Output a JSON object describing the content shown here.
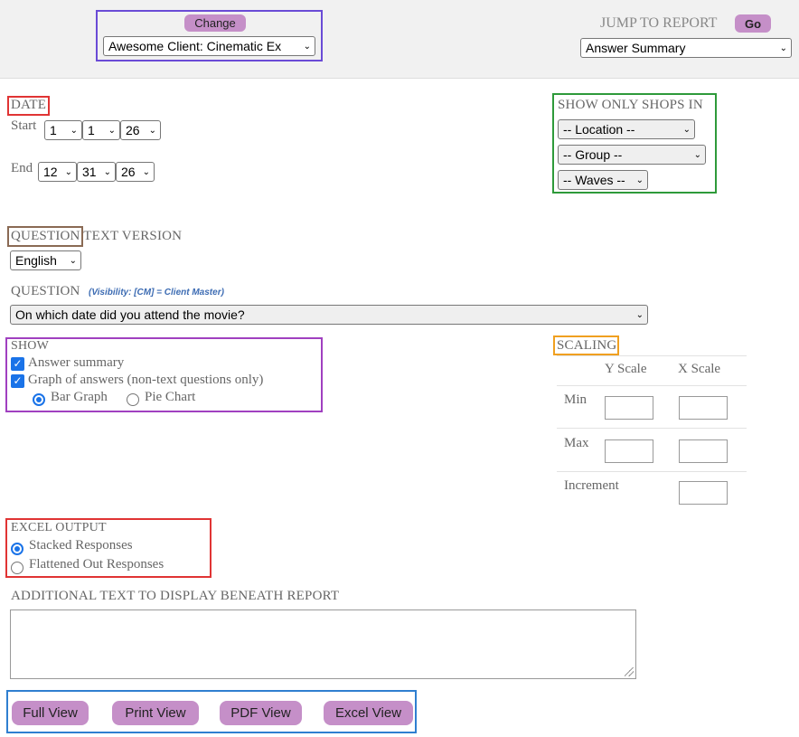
{
  "header": {
    "change_label": "Change",
    "client_select": "Awesome Client: Cinematic Ex",
    "jump_label": "JUMP TO REPORT",
    "go_label": "Go",
    "report_select": "Answer Summary"
  },
  "date": {
    "title": "DATE",
    "start_label": "Start",
    "start": [
      "1",
      "1",
      "26"
    ],
    "end_label": "End",
    "end": [
      "12",
      "31",
      "26"
    ]
  },
  "shops": {
    "title": "SHOW ONLY SHOPS IN",
    "location": "-- Location --",
    "group": "-- Group --",
    "waves": "-- Waves --"
  },
  "question_version": {
    "title_part1": "QUESTION",
    "title_part2": "TEXT VERSION",
    "language": "English"
  },
  "question": {
    "title": "QUESTION",
    "note": "(Visibility: [CM] = Client Master)",
    "selected": "On which date did you attend the movie?"
  },
  "show": {
    "title": "SHOW",
    "answer_summary": "Answer summary",
    "graph": "Graph of answers (non-text questions only)",
    "bar": "Bar Graph",
    "pie": "Pie Chart",
    "answer_summary_checked": true,
    "graph_checked": true,
    "selected_graph": "bar"
  },
  "scaling": {
    "title": "SCALING",
    "y_header": "Y Scale",
    "x_header": "X Scale",
    "min": "Min",
    "max": "Max",
    "increment": "Increment"
  },
  "excel": {
    "title": "EXCEL OUTPUT",
    "stacked": "Stacked Responses",
    "flattened": "Flattened Out Responses",
    "selected": "stacked"
  },
  "additional": {
    "title": "ADDITIONAL TEXT TO DISPLAY BENEATH REPORT",
    "value": ""
  },
  "views": {
    "full": "Full View",
    "print": "Print View",
    "pdf": "PDF View",
    "excel": "Excel View"
  },
  "colors": {
    "button": "#c58fc8",
    "accent_blue": "#1a73e8",
    "frame_purple": "#6a4bd6",
    "frame_red": "#e03434",
    "frame_green": "#2e9a3a",
    "frame_brown": "#8a6a54",
    "frame_violet": "#a040c0",
    "frame_orange": "#f0a020",
    "frame_blue": "#2f7fd0"
  }
}
